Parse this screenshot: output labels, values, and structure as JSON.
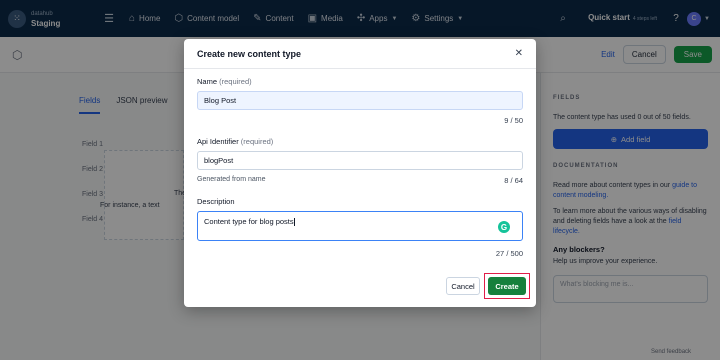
{
  "nav": {
    "space_name": "datahub",
    "environment": "Staging",
    "items": [
      {
        "label": "Home",
        "icon": "home-icon"
      },
      {
        "label": "Content model",
        "icon": "cube-icon"
      },
      {
        "label": "Content",
        "icon": "edit-icon"
      },
      {
        "label": "Media",
        "icon": "image-icon"
      },
      {
        "label": "Apps",
        "icon": "puzzle-icon"
      },
      {
        "label": "Settings",
        "icon": "gear-icon"
      }
    ],
    "quickstart_title": "Quick start",
    "quickstart_sub": "4 steps left",
    "help": "?",
    "avatar_initial": "C"
  },
  "toolbar": {
    "edit_label": "Edit",
    "cancel_label": "Cancel",
    "save_label": "Save"
  },
  "page": {
    "tab_fields": "Fields",
    "tab_json": "JSON preview",
    "field_rows": [
      "Field 1",
      "Field 2",
      "Field 3",
      "Field 4"
    ],
    "empty_text_1": "The",
    "empty_text_2": "For instance, a text"
  },
  "sidebar": {
    "fields_heading": "FIELDS",
    "fields_text": "The content type has used 0 out of 50 fields.",
    "add_field_label": "Add field",
    "doc_heading": "DOCUMENTATION",
    "doc_text_1": "Read more about content types in our",
    "doc_link_1": "guide to content modeling.",
    "doc_text_2": "To learn more about the various ways of disabling and deleting fields have a look at the",
    "doc_link_2": "field lifecycle.",
    "blockers_title": "Any blockers?",
    "blockers_sub": "Help us improve your experience.",
    "blockers_placeholder": "What's blocking me is...",
    "feedback_label": "Send feedback"
  },
  "modal": {
    "title": "Create new content type",
    "name_label": "Name",
    "name_required": "(required)",
    "name_value": "Blog Post",
    "name_count": "9 / 50",
    "api_label": "Api Identifier",
    "api_required": "(required)",
    "api_value": "blogPost",
    "api_hint": "Generated from name",
    "api_count": "8 / 64",
    "desc_label": "Description",
    "desc_value": "Content type for blog posts",
    "desc_count": "27 / 500",
    "cancel_label": "Cancel",
    "create_label": "Create"
  },
  "colors": {
    "nav_bg": "#0b2a4a",
    "primary": "#2563eb",
    "create_green": "#16803c",
    "highlight_red": "#e11d48"
  }
}
